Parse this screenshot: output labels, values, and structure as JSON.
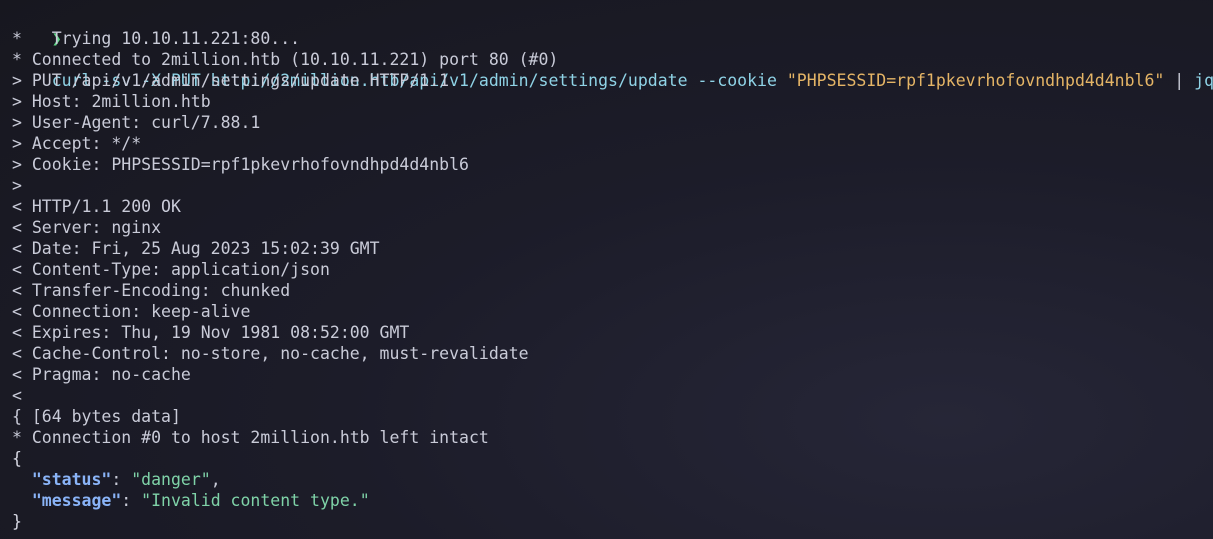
{
  "prompt": {
    "arrow": "❯",
    "command": "curl -sv -X PUT http://2million.htb/api/v1/admin/settings/update --cookie ",
    "cookie_arg": "\"PHPSESSID=rpf1pkevrhofovndhpd4d4nbl6\"",
    "pipe": " | ",
    "pipe_cmd": "jq"
  },
  "output_lines": [
    "*   Trying 10.10.11.221:80...",
    "* Connected to 2million.htb (10.10.11.221) port 80 (#0)",
    "> PUT /api/v1/admin/settings/update HTTP/1.1",
    "> Host: 2million.htb",
    "> User-Agent: curl/7.88.1",
    "> Accept: */*",
    "> Cookie: PHPSESSID=rpf1pkevrhofovndhpd4d4nbl6",
    ">",
    "< HTTP/1.1 200 OK",
    "< Server: nginx",
    "< Date: Fri, 25 Aug 2023 15:02:39 GMT",
    "< Content-Type: application/json",
    "< Transfer-Encoding: chunked",
    "< Connection: keep-alive",
    "< Expires: Thu, 19 Nov 1981 08:52:00 GMT",
    "< Cache-Control: no-store, no-cache, must-revalidate",
    "< Pragma: no-cache",
    "<",
    "{ [64 bytes data]",
    "* Connection #0 to host 2million.htb left intact"
  ],
  "json_output": {
    "open_brace": "{",
    "close_brace": "}",
    "status_key": "\"status\"",
    "status_sep": ": ",
    "status_value": "\"danger\"",
    "status_comma": ",",
    "message_key": "\"message\"",
    "message_sep": ": ",
    "message_value": "\"Invalid content type.\""
  },
  "colors": {
    "background": "#1c1c29",
    "prompt_arrow": "#5fd787",
    "command": "#8fd3e6",
    "string_arg": "#e5b566",
    "json_key": "#8ab4f8",
    "json_string": "#7fd3a8",
    "text": "#c9cbd8"
  }
}
